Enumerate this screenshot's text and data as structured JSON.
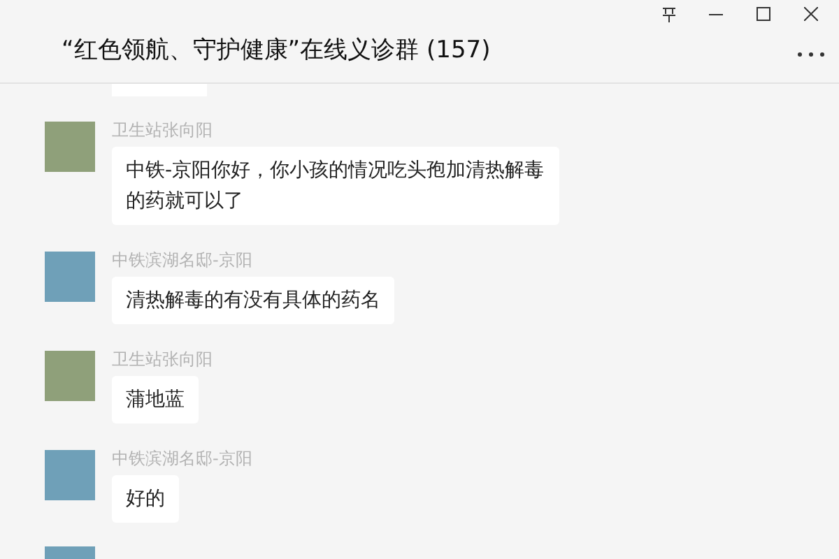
{
  "window": {
    "title": "“红色领航、守护健康”在线义诊群 (157)"
  },
  "messages": [
    {
      "sender": "卫生站张向阳",
      "text": "中铁-京阳你好，你小孩的情况吃头孢加清热解毒的药就可以了"
    },
    {
      "sender": "中铁滨湖名邸-京阳",
      "text": "清热解毒的有没有具体的药名"
    },
    {
      "sender": "卫生站张向阳",
      "text": "蒲地蓝"
    },
    {
      "sender": "中铁滨湖名邸-京阳",
      "text": "好的"
    }
  ]
}
